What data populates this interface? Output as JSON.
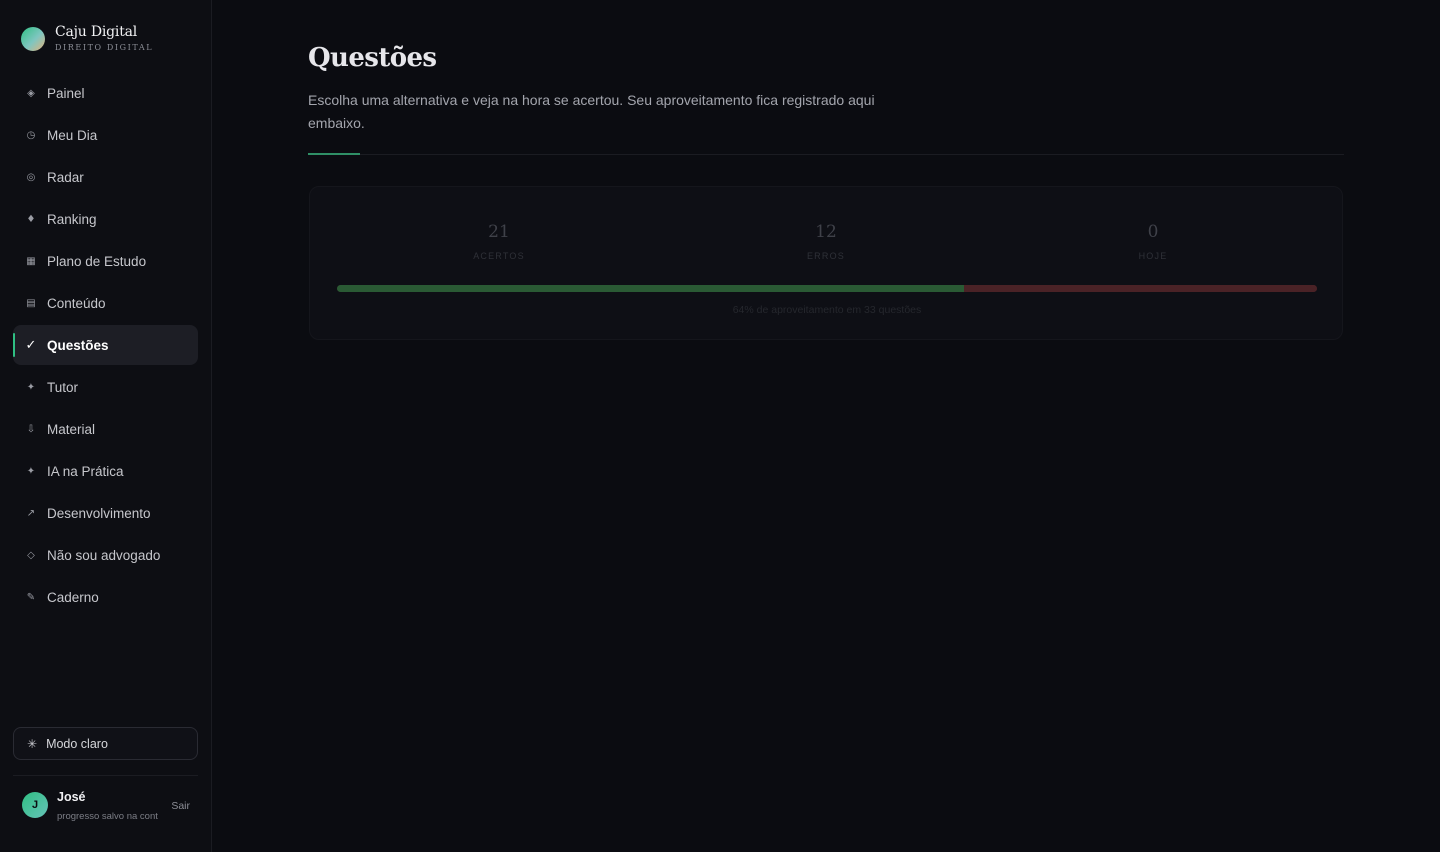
{
  "brand": {
    "name": "Caju Digital",
    "subtitle": "DIREITO DIGITAL"
  },
  "sidebar": {
    "items": [
      {
        "icon": "◈",
        "icon_name": "diamond-icon",
        "label": "Painel"
      },
      {
        "icon": "◷",
        "icon_name": "clock-icon",
        "label": "Meu Dia"
      },
      {
        "icon": "◎",
        "icon_name": "target-icon",
        "label": "Radar"
      },
      {
        "icon": "♦",
        "icon_name": "trophy-icon",
        "label": "Ranking"
      },
      {
        "icon": "▦",
        "icon_name": "calendar-grid-icon",
        "label": "Plano de Estudo"
      },
      {
        "icon": "▤",
        "icon_name": "book-icon",
        "label": "Conteúdo"
      },
      {
        "icon": "✓",
        "icon_name": "check-icon",
        "label": "Questões",
        "active": true
      },
      {
        "icon": "✦",
        "icon_name": "sparkle-icon",
        "label": "Tutor"
      },
      {
        "icon": "⇩",
        "icon_name": "download-icon",
        "label": "Material"
      },
      {
        "icon": "✦",
        "icon_name": "sparkle-icon",
        "label": "IA na Prática"
      },
      {
        "icon": "↗",
        "icon_name": "trend-up-icon",
        "label": "Desenvolvimento"
      },
      {
        "icon": "◇",
        "icon_name": "diamond-outline-icon",
        "label": "Não sou advogado"
      },
      {
        "icon": "✎",
        "icon_name": "pencil-icon",
        "label": "Caderno"
      }
    ],
    "mode_toggle": {
      "icon": "✳",
      "label": "Modo claro"
    },
    "user": {
      "initial": "J",
      "name": "José",
      "subtitle": "progresso salvo na cont",
      "logout_label": "Sair"
    }
  },
  "main": {
    "title": "Questões",
    "description": "Escolha uma alternativa e veja na hora se acertou. Seu aproveitamento fica registrado aqui embaixo.",
    "stats": [
      {
        "value": "21",
        "label": "ACERTOS"
      },
      {
        "value": "12",
        "label": "ERROS"
      },
      {
        "value": "0",
        "label": "HOJE"
      }
    ],
    "progress": {
      "percent": 64,
      "caption": "64% de aproveitamento em 33 questões"
    }
  },
  "colors": {
    "background": "#0b0c11",
    "sidebar": "#0d0e13",
    "accent": "#2fbf83",
    "success_bar": "#2a5a34",
    "error_bar": "#4a2226"
  }
}
